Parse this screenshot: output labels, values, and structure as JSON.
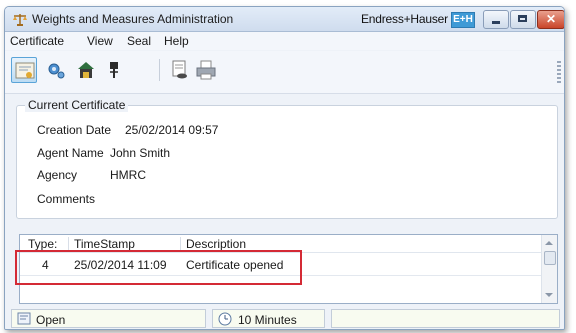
{
  "window": {
    "title": "Weights and Measures Administration",
    "brand": "Endress+Hauser",
    "brand_logo": "E+H",
    "close_label": "✕"
  },
  "menu": [
    "Certificate",
    "View",
    "Seal",
    "Help"
  ],
  "toolbar": {
    "icons": [
      "certificate-icon",
      "settings-icon",
      "seal-vault-icon",
      "pin-icon",
      "report-preview-icon",
      "printer-icon"
    ]
  },
  "current_certificate": {
    "legend": "Current Certificate",
    "fields": [
      {
        "label": "Creation Date",
        "value": "25/02/2014 09:57"
      },
      {
        "label": "Agent Name",
        "value": "John Smith"
      },
      {
        "label": "Agency",
        "value": "HMRC"
      },
      {
        "label": "Comments",
        "value": ""
      }
    ]
  },
  "events": {
    "columns": [
      "Type:",
      "TimeStamp",
      "Description"
    ],
    "rows": [
      {
        "type": "4",
        "timestamp": "25/02/2014 11:09",
        "description": "Certificate opened"
      }
    ]
  },
  "status": {
    "state": "Open",
    "timer": "10 Minutes"
  },
  "colors": {
    "highlight": "#d42a35",
    "status_bg": "#f8fbf0"
  }
}
